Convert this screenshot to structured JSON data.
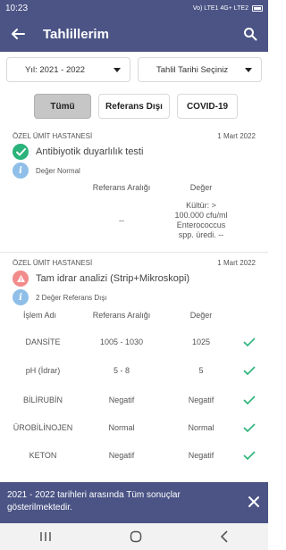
{
  "status": {
    "time": "10:23",
    "network": "Vo) LTE1 4G+ LTE2",
    "battery_icon": "battery-icon"
  },
  "appbar": {
    "title": "Tahlillerim"
  },
  "filters": {
    "year": "Yıl: 2021 - 2022",
    "date": "Tahlil Tarihi Seçiniz"
  },
  "tabs": [
    "Tümü",
    "Referans Dışı",
    "COVID-19"
  ],
  "card1": {
    "hospital": "ÖZEL ÜMİT HASTANESİ",
    "date": "1 Mart 2022",
    "test_name": "Antibiyotik duyarlılık testi",
    "status": "Değer Normal",
    "col_ref": "Referans Aralığı",
    "col_val": "Değer",
    "ref": "--",
    "value_lines": [
      "Kültür: >",
      "100.000 cfu/ml",
      "Enterococcus",
      "spp. üredi. --"
    ]
  },
  "card2": {
    "hospital": "ÖZEL ÜMİT HASTANESİ",
    "date": "1 Mart 2022",
    "test_name": "Tam idrar analizi (Strip+Mikroskopi)",
    "status": "2 Değer Referans Dışı",
    "col_name": "İşlem Adı",
    "col_ref": "Referans Aralığı",
    "col_val": "Değer",
    "rows": [
      {
        "name": "DANSİTE",
        "ref": "1005 - 1030",
        "value": "1025"
      },
      {
        "name": "pH (İdrar)",
        "ref": "5 - 8",
        "value": "5"
      },
      {
        "name": "BİLİRUBİN",
        "ref": "Negatif",
        "value": "Negatif"
      },
      {
        "name": "ÜROBİLİNOJEN",
        "ref": "Normal",
        "value": "Normal"
      },
      {
        "name": "KETON",
        "ref": "Negatif",
        "value": "Negatif"
      }
    ]
  },
  "snackbar": {
    "line1": "2021 - 2022 tarihleri arasında Tüm sonuçlar",
    "line2": "gösterilmektedir."
  },
  "colors": {
    "primary": "#4b5485",
    "success": "#2ab37a",
    "warning": "#f28b8b",
    "info": "#8fbfe8"
  }
}
